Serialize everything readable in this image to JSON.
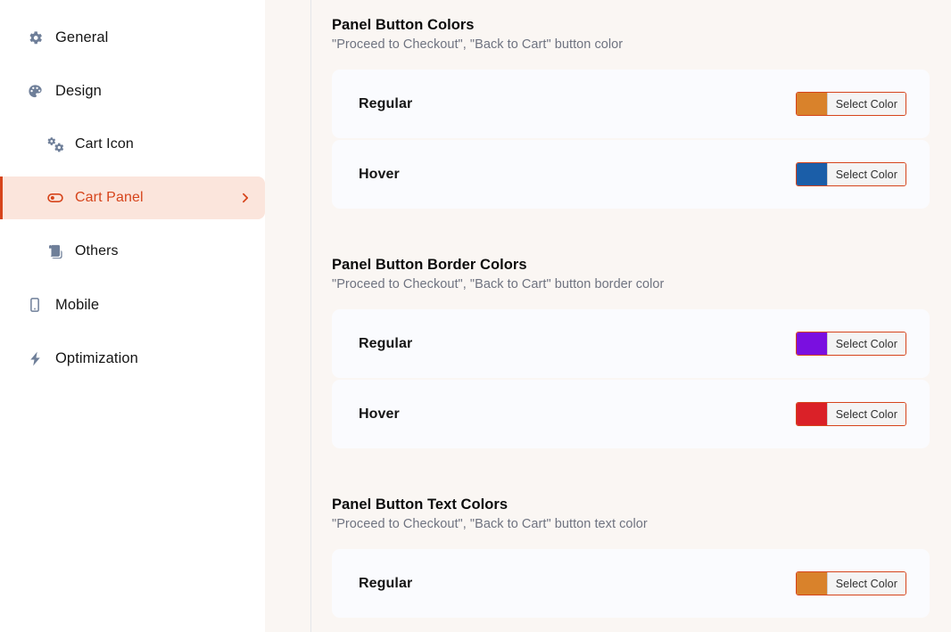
{
  "sidebar": {
    "items": [
      {
        "label": "General",
        "icon": "gear-icon",
        "level": 0,
        "active": false,
        "chevron": false
      },
      {
        "label": "Design",
        "icon": "palette-icon",
        "level": 0,
        "active": false,
        "chevron": false
      },
      {
        "label": "Cart Icon",
        "icon": "gears-icon",
        "level": 1,
        "active": false,
        "chevron": false
      },
      {
        "label": "Cart Panel",
        "icon": "toggle-icon",
        "level": 1,
        "active": true,
        "chevron": true
      },
      {
        "label": "Others",
        "icon": "scroll-icon",
        "level": 1,
        "active": false,
        "chevron": false
      },
      {
        "label": "Mobile",
        "icon": "mobile-icon",
        "level": 0,
        "active": false,
        "chevron": false
      },
      {
        "label": "Optimization",
        "icon": "lightning-icon",
        "level": 0,
        "active": false,
        "chevron": false
      }
    ],
    "active_accent_color": "#D6441B",
    "active_background_color": "#FBE5DC",
    "icon_color": "#6F7F99"
  },
  "main": {
    "sections": [
      {
        "title": "Panel Button Colors",
        "subtitle": "\"Proceed to Checkout\", \"Back to Cart\" button color",
        "rows": [
          {
            "label": "Regular",
            "color": "#D9822B",
            "button_label": "Select Color"
          },
          {
            "label": "Hover",
            "color": "#1B5EA8",
            "button_label": "Select Color"
          }
        ]
      },
      {
        "title": "Panel Button Border Colors",
        "subtitle": "\"Proceed to Checkout\", \"Back to Cart\" button border color",
        "rows": [
          {
            "label": "Regular",
            "color": "#7A0FE0",
            "button_label": "Select Color"
          },
          {
            "label": "Hover",
            "color": "#DA2128",
            "button_label": "Select Color"
          }
        ]
      },
      {
        "title": "Panel Button Text Colors",
        "subtitle": "\"Proceed to Checkout\", \"Back to Cart\" button text color",
        "rows": [
          {
            "label": "Regular",
            "color": "#D9822B",
            "button_label": "Select Color"
          }
        ]
      }
    ]
  }
}
